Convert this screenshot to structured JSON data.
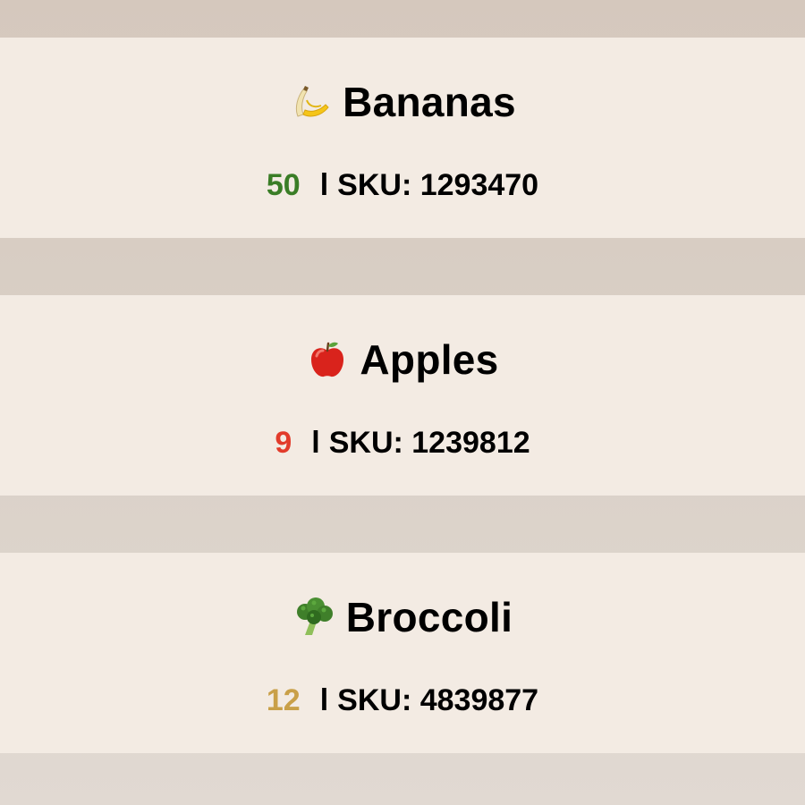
{
  "colors": {
    "qty_high": "#3a7d26",
    "qty_low": "#e23b2b",
    "qty_mid": "#c9a048"
  },
  "products": [
    {
      "icon": "banana-icon",
      "name": "Bananas",
      "quantity": "50",
      "quantity_color": "#3a7d26",
      "separator": "l",
      "sku_label": "SKU: 1293470"
    },
    {
      "icon": "apple-icon",
      "name": "Apples",
      "quantity": "9",
      "quantity_color": "#e23b2b",
      "separator": "l",
      "sku_label": "SKU: 1239812"
    },
    {
      "icon": "broccoli-icon",
      "name": "Broccoli",
      "quantity": "12",
      "quantity_color": "#c9a048",
      "separator": "l",
      "sku_label": "SKU: 4839877"
    }
  ]
}
